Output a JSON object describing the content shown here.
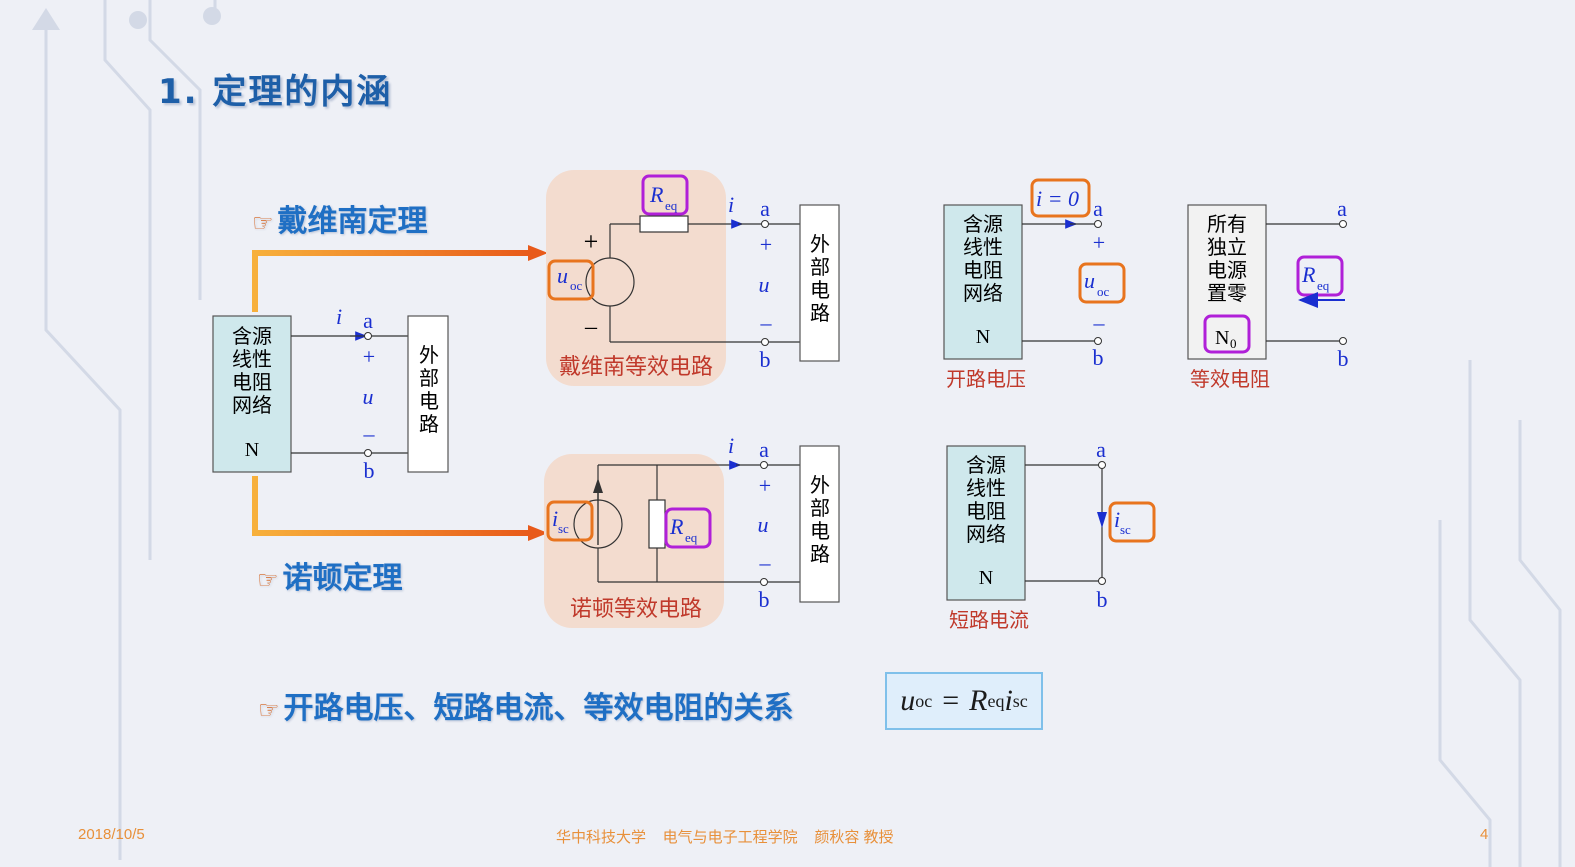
{
  "slide": {
    "title": "1. 定理的内涵",
    "bullet_hand_icon": "pointing-hand-icon",
    "bullet_thevenin": "戴维南定理",
    "bullet_norton": "诺顿定理",
    "bullet_relation": "开路电压、短路电流、等效电阻的关系",
    "formula": {
      "u": "u",
      "oc": "oc",
      "eq_sign": "=",
      "R": "R",
      "eq": "eq",
      "i": "i",
      "sc": "sc"
    }
  },
  "labels": {
    "network_lines": [
      "含源",
      "线性",
      "电阻",
      "网络"
    ],
    "zeroed_lines": [
      "所有",
      "独立",
      "电源",
      "置零"
    ],
    "external_lines": [
      "外",
      "部",
      "电",
      "路"
    ],
    "N": "N",
    "N0_main": "N",
    "N0_sub": "0",
    "a": "a",
    "b": "b",
    "i": "i",
    "u": "u",
    "plus": "+",
    "minus": "–",
    "i_eq_0": "i = 0",
    "thevenin_eq_circuit": "戴维南等效电路",
    "norton_eq_circuit": "诺顿等效电路",
    "open_voltage": "开路电压",
    "equiv_resistance": "等效电阻",
    "short_current": "短路电流"
  },
  "footer": {
    "date": "2018/10/5",
    "center": "华中科技大学    电气与电子工程学院    颜秋容 教授",
    "page": "4"
  },
  "colors": {
    "blue_text": "#1f6fc4",
    "label_blue": "#1a2fd0",
    "orange": "#e8741e",
    "purple": "#b020d8",
    "red_caption": "#c0392b",
    "network_fill": "#cfe8ec",
    "eq_bg": "#f3dccf"
  }
}
